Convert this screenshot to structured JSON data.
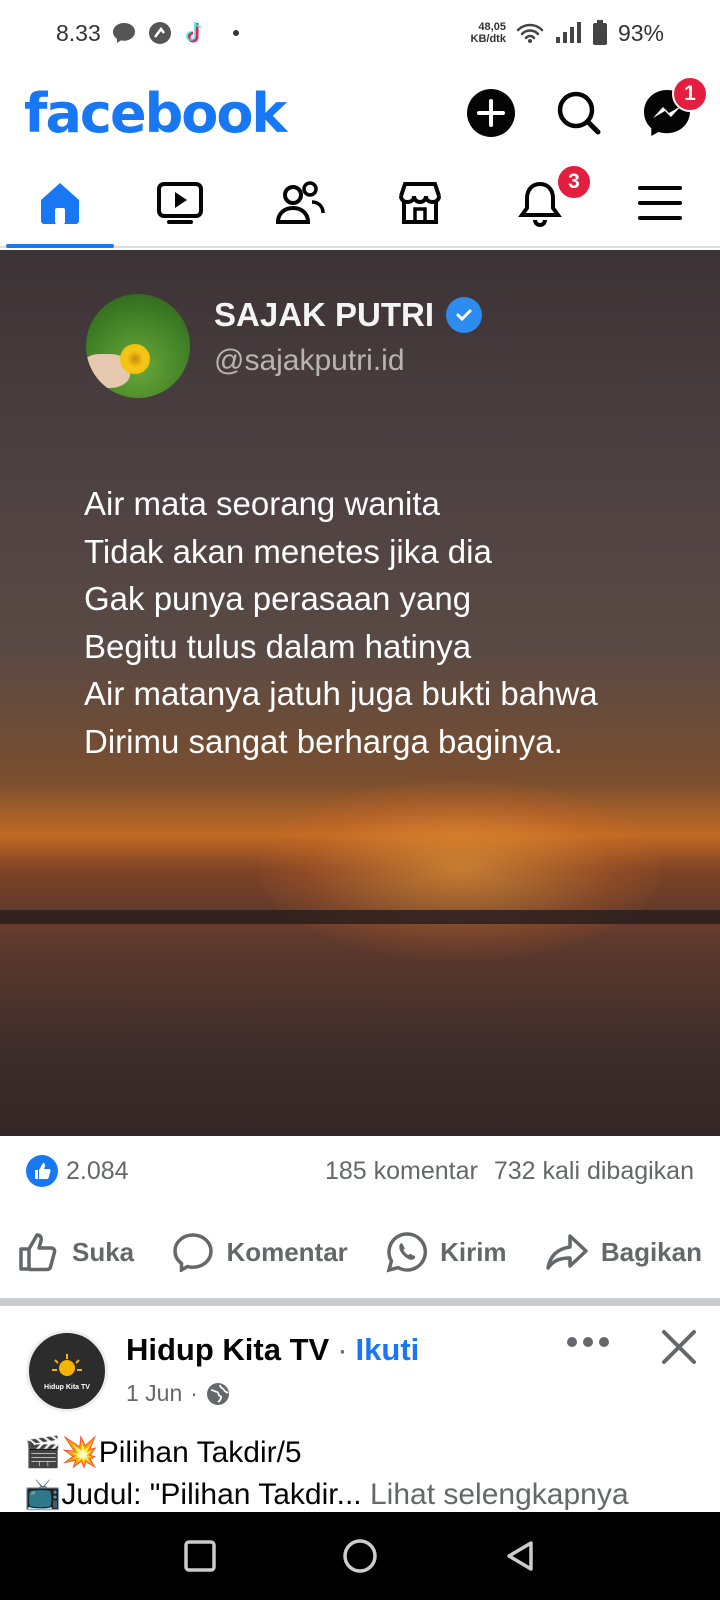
{
  "status_bar": {
    "time": "8.33",
    "speed_value": "48,05",
    "speed_unit": "KB/dtk",
    "battery": "93%",
    "icons": [
      "chat-bubble-icon",
      "whatsapp-status-icon",
      "tiktok-icon",
      "wifi-icon",
      "signal-icon",
      "battery-icon"
    ]
  },
  "header": {
    "logo": "facebook",
    "messenger_badge": "1"
  },
  "tabs": {
    "items": [
      "home",
      "watch",
      "friends",
      "marketplace",
      "notifications",
      "menu"
    ],
    "notifications_badge": "3",
    "active": "home"
  },
  "post1": {
    "account_name": "SAJAK PUTRI",
    "account_handle": "@sajakputri.id",
    "poem": [
      "Air mata seorang wanita",
      "Tidak akan menetes jika dia",
      "Gak punya perasaan yang",
      "Begitu tulus dalam hatinya",
      "Air matanya jatuh juga bukti bahwa",
      "Dirimu sangat berharga baginya."
    ],
    "like_count": "2.084",
    "comments": "185 komentar",
    "shares": "732 kali dibagikan",
    "actions": {
      "like": "Suka",
      "comment": "Komentar",
      "send": "Kirim",
      "share": "Bagikan"
    }
  },
  "post2": {
    "page_name": "Hidup Kita TV",
    "separator": "·",
    "follow": "Ikuti",
    "date": "1 Jun",
    "date_sep": "·",
    "avatar_text": "Hidup Kita TV",
    "line1_emoji": "🎬💥",
    "line1": "Pilihan Takdir/5",
    "line2_emoji": "📺",
    "line2": "Judul: \"Pilihan Takdir...",
    "see_more": "Lihat selengkapnya"
  },
  "colors": {
    "brand": "#1877f2",
    "badge": "#e41e3f",
    "secondary_text": "#65676b"
  }
}
